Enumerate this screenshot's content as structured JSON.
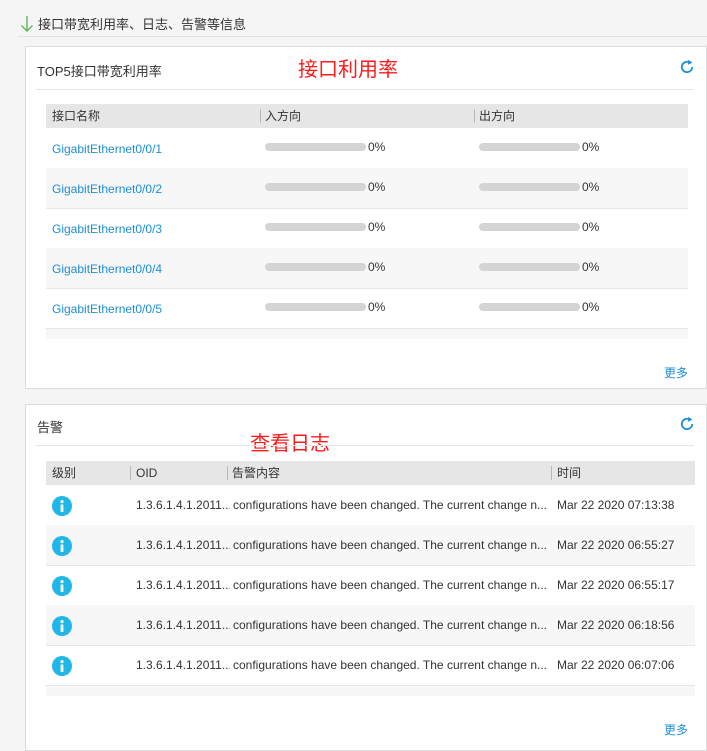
{
  "section": {
    "title": "接口带宽利用率、日志、告警等信息"
  },
  "bandwidth": {
    "title": "TOP5接口带宽利用率",
    "annotation": "接口利用率",
    "columns": [
      "接口名称",
      "入方向",
      "出方向"
    ],
    "rows": [
      {
        "name": "GigabitEthernet0/0/1",
        "in": 0,
        "in_label": "0%",
        "out": 0,
        "out_label": "0%"
      },
      {
        "name": "GigabitEthernet0/0/2",
        "in": 0,
        "in_label": "0%",
        "out": 0,
        "out_label": "0%"
      },
      {
        "name": "GigabitEthernet0/0/3",
        "in": 0,
        "in_label": "0%",
        "out": 0,
        "out_label": "0%"
      },
      {
        "name": "GigabitEthernet0/0/4",
        "in": 0,
        "in_label": "0%",
        "out": 0,
        "out_label": "0%"
      },
      {
        "name": "GigabitEthernet0/0/5",
        "in": 0,
        "in_label": "0%",
        "out": 0,
        "out_label": "0%"
      }
    ],
    "more_label": "更多"
  },
  "alarms": {
    "title": "告警",
    "annotation": "查看日志",
    "columns": [
      "级别",
      "OID",
      "告警内容",
      "时间"
    ],
    "rows": [
      {
        "level_icon": "info-icon",
        "oid": "1.3.6.1.4.1.2011...",
        "content": "configurations have been changed. The current change n...",
        "time": "Mar 22 2020 07:13:38"
      },
      {
        "level_icon": "info-icon",
        "oid": "1.3.6.1.4.1.2011...",
        "content": "configurations have been changed. The current change n...",
        "time": "Mar 22 2020 06:55:27"
      },
      {
        "level_icon": "info-icon",
        "oid": "1.3.6.1.4.1.2011...",
        "content": "configurations have been changed. The current change n...",
        "time": "Mar 22 2020 06:55:17"
      },
      {
        "level_icon": "info-icon",
        "oid": "1.3.6.1.4.1.2011...",
        "content": "configurations have been changed. The current change n...",
        "time": "Mar 22 2020 06:18:56"
      },
      {
        "level_icon": "info-icon",
        "oid": "1.3.6.1.4.1.2011...",
        "content": "configurations have been changed. The current change n...",
        "time": "Mar 22 2020 06:07:06"
      }
    ],
    "more_label": "更多"
  },
  "colors": {
    "link": "#1c8fd6",
    "annotation": "#ff1a1a",
    "info_icon": "#1fb6e8",
    "refresh": "#1c8fd6"
  }
}
